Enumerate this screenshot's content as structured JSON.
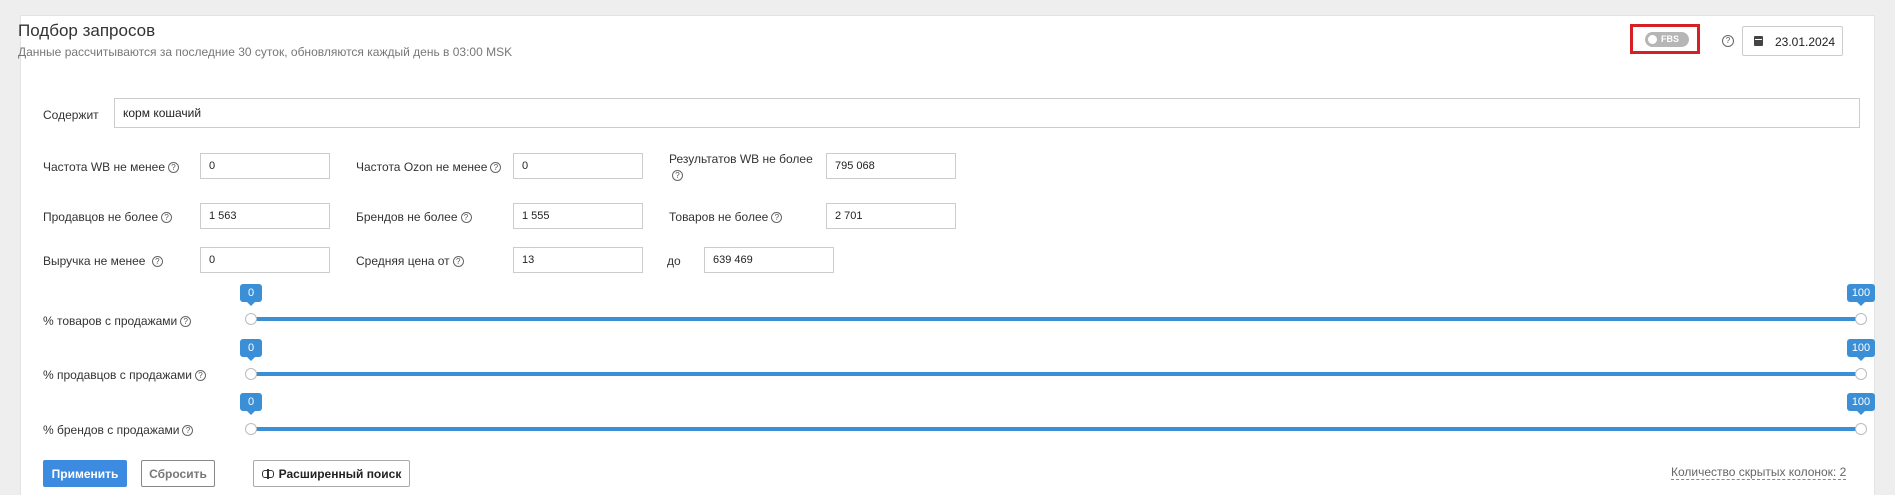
{
  "header": {
    "title": "Подбор запросов",
    "subtitle": "Данные рассчитываются за последние 30 суток, обновляются каждый день в 03:00 MSK",
    "fbs_label": "FBS",
    "help_glyph": "?",
    "date": "23.01.2024"
  },
  "filters": {
    "contains": {
      "label": "Содержит",
      "value": "корм кошачий"
    },
    "freq_wb": {
      "label": "Частота WB не менее",
      "value": "0"
    },
    "freq_ozon": {
      "label": "Частота Ozon не менее",
      "value": "0"
    },
    "results_wb": {
      "label": "Результатов WB не более",
      "value": "795 068"
    },
    "sellers": {
      "label": "Продавцов не более",
      "value": "1 563"
    },
    "brands": {
      "label": "Брендов не более",
      "value": "1 555"
    },
    "goods": {
      "label": "Товаров не более",
      "value": "2 701"
    },
    "revenue": {
      "label": "Выручка не менее",
      "value": "0"
    },
    "avg_price": {
      "label": "Средняя цена от",
      "value": "13"
    },
    "avg_price_to": {
      "label": "до",
      "value": "639 469"
    }
  },
  "sliders": [
    {
      "label": "% товаров с продажами",
      "min_label": "0",
      "max_label": "100",
      "low": 0,
      "high": 100
    },
    {
      "label": "% продавцов с продажами",
      "min_label": "0",
      "max_label": "100",
      "low": 0,
      "high": 100
    },
    {
      "label": "% брендов с продажами",
      "min_label": "0",
      "max_label": "100",
      "low": 0,
      "high": 100
    }
  ],
  "actions": {
    "apply": "Применить",
    "reset": "Сбросить",
    "advanced": "Расширенный поиск"
  },
  "footer": {
    "hidden_columns": "Количество скрытых колонок:  2"
  },
  "colors": {
    "accent": "#3a8fd6",
    "highlight": "#d71f26"
  }
}
